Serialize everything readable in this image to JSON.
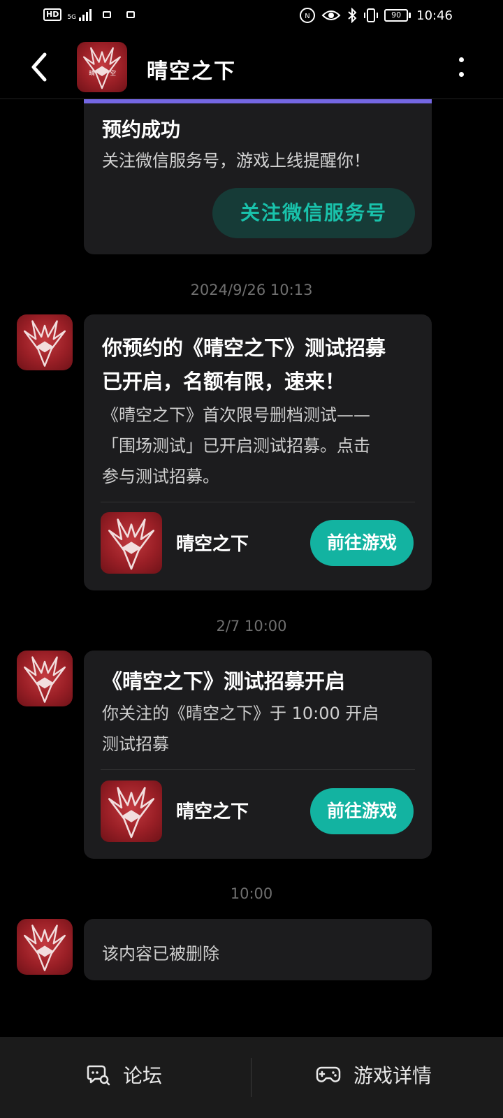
{
  "status_bar": {
    "hd": "HD",
    "network": "5G",
    "battery": "90",
    "time": "10:46"
  },
  "header": {
    "title": "晴空之下"
  },
  "messages": [
    {
      "title": "预约成功",
      "text": "关注微信服务号，游戏上线提醒你！",
      "button": "关注微信服务号"
    },
    {
      "timestamp": "2024/9/26  10:13",
      "title_line1": "你预约的《晴空之下》测试招募",
      "title_line2": "已开启，名额有限，速来！",
      "text_line1": "《晴空之下》首次限号删档测试——",
      "text_line2": "「围场测试」已开启测试招募。点击",
      "text_line3": "参与测试招募。",
      "game_name": "晴空之下",
      "button": "前往游戏"
    },
    {
      "timestamp": "2/7  10:00",
      "title": "《晴空之下》测试招募开启",
      "text_line1": "你关注的《晴空之下》于 10:00 开启",
      "text_line2": "测试招募",
      "game_name": "晴空之下",
      "button": "前往游戏"
    },
    {
      "timestamp": "10:00",
      "text": "该内容已被删除"
    }
  ],
  "bottom_nav": {
    "forum": "论坛",
    "game_details": "游戏详情"
  }
}
